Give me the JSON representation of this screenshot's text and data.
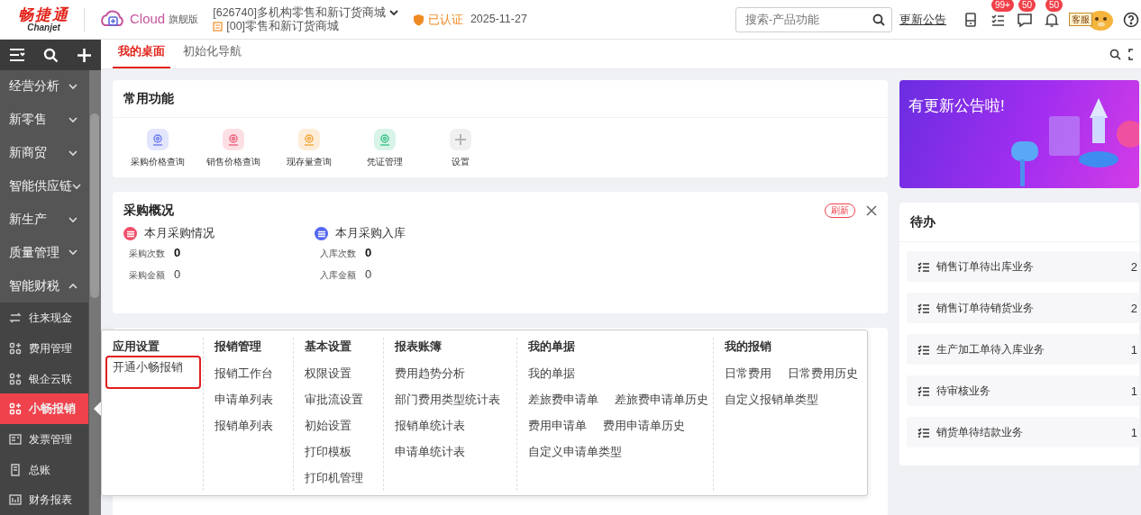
{
  "header": {
    "logo": {
      "name": "畅捷通",
      "sub": "Chanjet"
    },
    "product": {
      "name": "Cloud",
      "edition": "旗舰版"
    },
    "org": {
      "company": "[626740]多机构零售和新订货商城",
      "store": "[00]零售和新订货商城"
    },
    "verified": "已认证",
    "date": "2025-11-27",
    "search": {
      "placeholder": "搜索-产品功能"
    },
    "announce_link": "更新公告",
    "tools": [
      {
        "kind": "device"
      },
      {
        "kind": "tasks",
        "badge": "99+"
      },
      {
        "kind": "message",
        "badge": "50"
      },
      {
        "kind": "bell",
        "badge": "50"
      },
      {
        "kind": "mascot",
        "label": "客服"
      },
      {
        "kind": "help"
      }
    ]
  },
  "sidebar": {
    "modules": [
      {
        "label": "经营分析",
        "expanded": false
      },
      {
        "label": "新零售",
        "expanded": false
      },
      {
        "label": "新商贸",
        "expanded": false
      },
      {
        "label": "智能供应链",
        "expanded": false
      },
      {
        "label": "新生产",
        "expanded": false
      },
      {
        "label": "质量管理",
        "expanded": false
      },
      {
        "label": "智能财税",
        "expanded": true,
        "children": [
          {
            "label": "往来现金",
            "selected": false
          },
          {
            "label": "费用管理",
            "selected": false
          },
          {
            "label": "银企云联",
            "selected": false
          },
          {
            "label": "小畅报销",
            "selected": true
          },
          {
            "label": "发票管理",
            "selected": false
          },
          {
            "label": "总账",
            "selected": false
          },
          {
            "label": "财务报表",
            "selected": false
          }
        ]
      }
    ]
  },
  "tabs": [
    {
      "label": "我的桌面",
      "selected": true
    },
    {
      "label": "初始化导航",
      "selected": false
    }
  ],
  "common_functions": {
    "title": "常用功能",
    "items": [
      {
        "label": "采购价格查询",
        "color": "#6d7cf0"
      },
      {
        "label": "销售价格查询",
        "color": "#f0607a"
      },
      {
        "label": "现存量查询",
        "color": "#f5a53a"
      },
      {
        "label": "凭证管理",
        "color": "#3cc48a"
      },
      {
        "label": "设置",
        "color": "#b4b4b4"
      }
    ]
  },
  "purchase_overview": {
    "title": "采购概况",
    "refresh": "刷新",
    "sections": [
      {
        "title": "本月采购情况",
        "color": "#f0506a",
        "metrics": [
          {
            "label": "采购次数",
            "value": "0",
            "bold": true
          },
          {
            "label": "采购金额",
            "value": "0",
            "bold": false
          }
        ]
      },
      {
        "title": "本月采购入库",
        "color": "#5468f0",
        "metrics": [
          {
            "label": "入库次数",
            "value": "0",
            "bold": true
          },
          {
            "label": "入库金额",
            "value": "0",
            "bold": false
          }
        ]
      }
    ]
  },
  "banner": {
    "text": "有更新公告啦!"
  },
  "todo": {
    "title": "待办",
    "items": [
      {
        "label": "销售订单待出库业务",
        "count": "2"
      },
      {
        "label": "销售订单待销货业务",
        "count": "2"
      },
      {
        "label": "生产加工单待入库业务",
        "count": "1"
      },
      {
        "label": "待审核业务",
        "count": "1"
      },
      {
        "label": "销货单待结款业务",
        "count": "1"
      }
    ]
  },
  "flyout_menu": {
    "columns": [
      {
        "title": "应用设置",
        "rows": [
          [
            {
              "label": "开通小畅报销",
              "highlighted": true
            }
          ]
        ]
      },
      {
        "title": "报销管理",
        "rows": [
          [
            {
              "label": "报销工作台",
              "highlighted": false
            }
          ],
          [
            {
              "label": "申请单列表",
              "highlighted": false
            }
          ],
          [
            {
              "label": "报销单列表",
              "highlighted": false
            }
          ]
        ]
      },
      {
        "title": "基本设置",
        "rows": [
          [
            {
              "label": "权限设置",
              "highlighted": false
            }
          ],
          [
            {
              "label": "审批流设置",
              "highlighted": false
            }
          ],
          [
            {
              "label": "初始设置",
              "highlighted": false
            }
          ],
          [
            {
              "label": "打印模板",
              "highlighted": false
            }
          ],
          [
            {
              "label": "打印机管理",
              "highlighted": false
            }
          ]
        ]
      },
      {
        "title": "报表账簿",
        "rows": [
          [
            {
              "label": "费用趋势分析",
              "highlighted": false
            }
          ],
          [
            {
              "label": "部门费用类型统计表",
              "highlighted": false
            }
          ],
          [
            {
              "label": "报销单统计表",
              "highlighted": false
            }
          ],
          [
            {
              "label": "申请单统计表",
              "highlighted": false
            }
          ]
        ]
      },
      {
        "title": "我的单据",
        "rows": [
          [
            {
              "label": "我的单据",
              "highlighted": false
            }
          ],
          [
            {
              "label": "差旅费申请单",
              "highlighted": false
            },
            {
              "label": "差旅费申请单历史",
              "highlighted": false
            }
          ],
          [
            {
              "label": "费用申请单",
              "highlighted": false
            },
            {
              "label": "费用申请单历史",
              "highlighted": false
            }
          ],
          [
            {
              "label": "自定义申请单类型",
              "highlighted": false
            }
          ]
        ]
      },
      {
        "title": "我的报销",
        "rows": [
          [
            {
              "label": "日常费用",
              "highlighted": false
            },
            {
              "label": "日常费用历史",
              "highlighted": false
            }
          ],
          [
            {
              "label": "自定义报销单类型",
              "highlighted": false
            }
          ]
        ]
      }
    ]
  }
}
